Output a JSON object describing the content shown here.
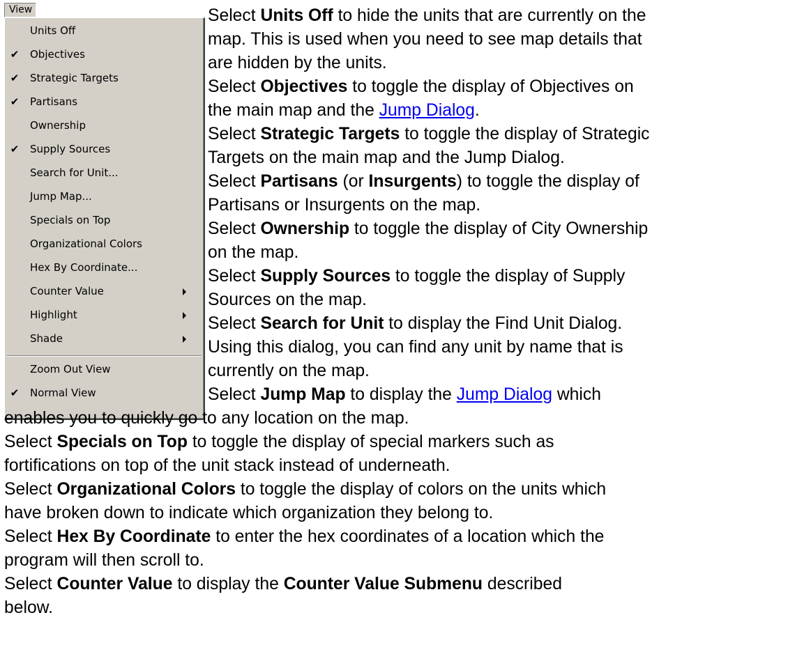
{
  "menu": {
    "title": "View",
    "items": [
      {
        "label": "Units Off",
        "checked": false,
        "submenu": false
      },
      {
        "label": "Objectives",
        "checked": true,
        "submenu": false
      },
      {
        "label": "Strategic Targets",
        "checked": true,
        "submenu": false
      },
      {
        "label": "Partisans",
        "checked": true,
        "submenu": false
      },
      {
        "label": "Ownership",
        "checked": false,
        "submenu": false
      },
      {
        "label": "Supply Sources",
        "checked": true,
        "submenu": false
      },
      {
        "label": "Search for Unit...",
        "checked": false,
        "submenu": false
      },
      {
        "label": "Jump Map...",
        "checked": false,
        "submenu": false
      },
      {
        "label": "Specials on Top",
        "checked": false,
        "submenu": false
      },
      {
        "label": "Organizational Colors",
        "checked": false,
        "submenu": false
      },
      {
        "label": "Hex By Coordinate...",
        "checked": false,
        "submenu": false
      },
      {
        "label": "Counter Value",
        "checked": false,
        "submenu": true
      },
      {
        "label": "Highlight",
        "checked": false,
        "submenu": true
      },
      {
        "label": "Shade",
        "checked": false,
        "submenu": true
      },
      {
        "label": "Zoom Out View",
        "checked": false,
        "submenu": false
      },
      {
        "label": "Normal View",
        "checked": true,
        "submenu": false
      }
    ],
    "check_glyph": "✔",
    "check_icon": "checkmark-icon",
    "submenu_icon": "submenu-arrow-icon"
  },
  "text": {
    "select": "Select",
    "l1_after": " to hide the units that are currently on the",
    "units_off": "Units Off",
    "l2": "map. This is used when you need to see map details that",
    "l3": "are hidden by the units.",
    "objectives": "Objectives",
    "l4_after": " to toggle the display of Objectives on",
    "l5_before": "the main map and the ",
    "jump_dialog": "Jump Dialog",
    "period": ".",
    "strategic_targets": "Strategic Targets",
    "l6_after": " to toggle the display of Strategic",
    "l7": "Targets on the main map and the Jump Dialog.",
    "partisans": "Partisans",
    "l8_mid1": " (or ",
    "insurgents": "Insurgents",
    "l8_after": ") to toggle the display of",
    "l9": "Partisans or Insurgents on the map.",
    "ownership": "Ownership",
    "l10_after": " to toggle the display of City Ownership",
    "l11": "on the map.",
    "supply_sources": "Supply Sources",
    "l12_after": " to toggle the display of Supply",
    "l13": "Sources on the map.",
    "search_for_unit": "Search for Unit",
    "l14_after": " to display the Find Unit Dialog.",
    "l15": "Using this dialog, you can find any unit by name that is",
    "l16": "currently on the map.",
    "jump_map": "Jump Map",
    "l17_mid": " to display the ",
    "l17_after": " which",
    "l18": "enables you to quickly go to any location on the map.",
    "specials_on_top": "Specials on Top",
    "l19_after": " to toggle the display of special markers such as",
    "l20": "fortifications on top of the unit stack instead of underneath.",
    "organizational_colors": "Organizational Colors",
    "l21_after": " to toggle the display of colors on the units which",
    "l22": "have broken down to indicate which organization they belong to.",
    "hex_by_coordinate": "Hex By Coordinate",
    "l23_after": " to enter the hex coordinates of a location which the",
    "l24": "program will then scroll to.",
    "counter_value": "Counter Value",
    "l25_mid": " to display the ",
    "counter_value_submenu": "Counter Value Submenu",
    "l25_after": " described",
    "l26": "below."
  }
}
